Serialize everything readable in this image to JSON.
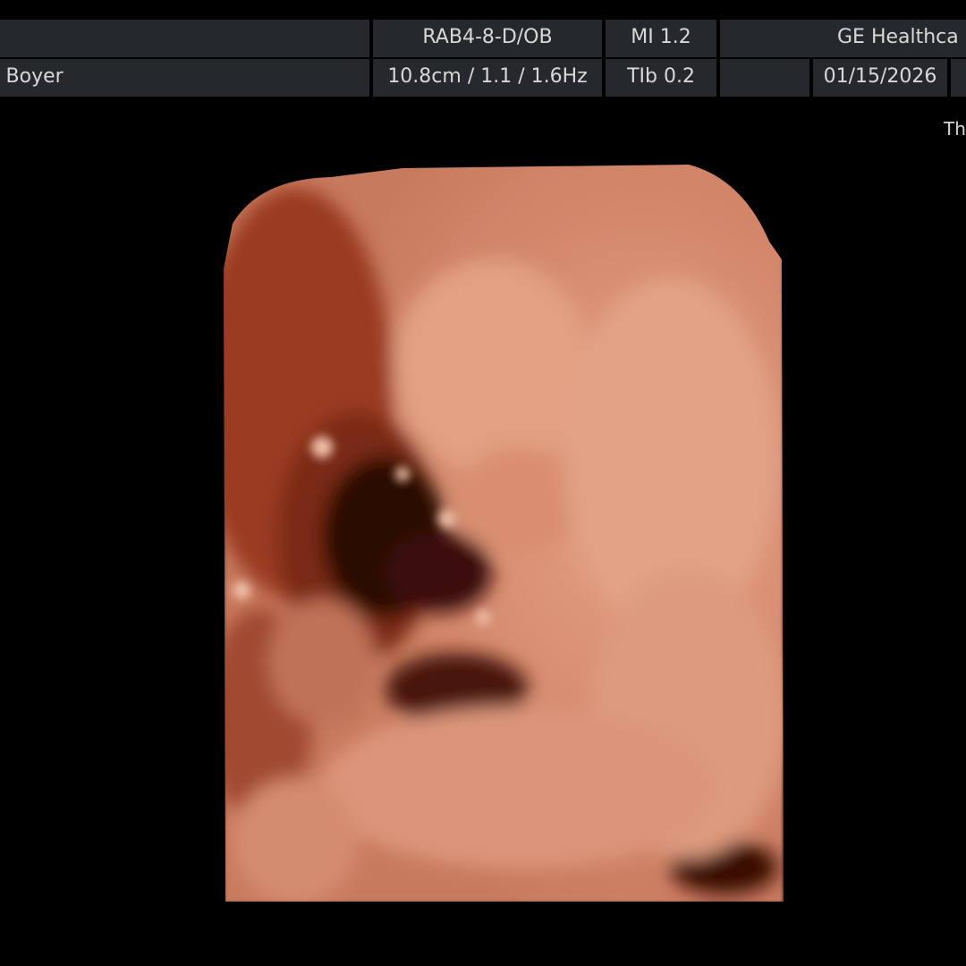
{
  "header": {
    "patient_name": "e Boyer",
    "probe": "RAB4-8-D/OB",
    "depth_gain_rate": "10.8cm / 1.1 / 1.6Hz",
    "mi": "MI  1.2",
    "tib": "TIb  0.2",
    "vendor": "GE Healthca",
    "date": "01/15/2026"
  },
  "overlay": {
    "right_label": "Th"
  },
  "colors": {
    "background": "#000000",
    "header_cell": "#25282c",
    "render_tone": "#d48a6e"
  },
  "image": {
    "type": "3D ultrasound surface rendering",
    "icon": "fetal-3d-render"
  }
}
